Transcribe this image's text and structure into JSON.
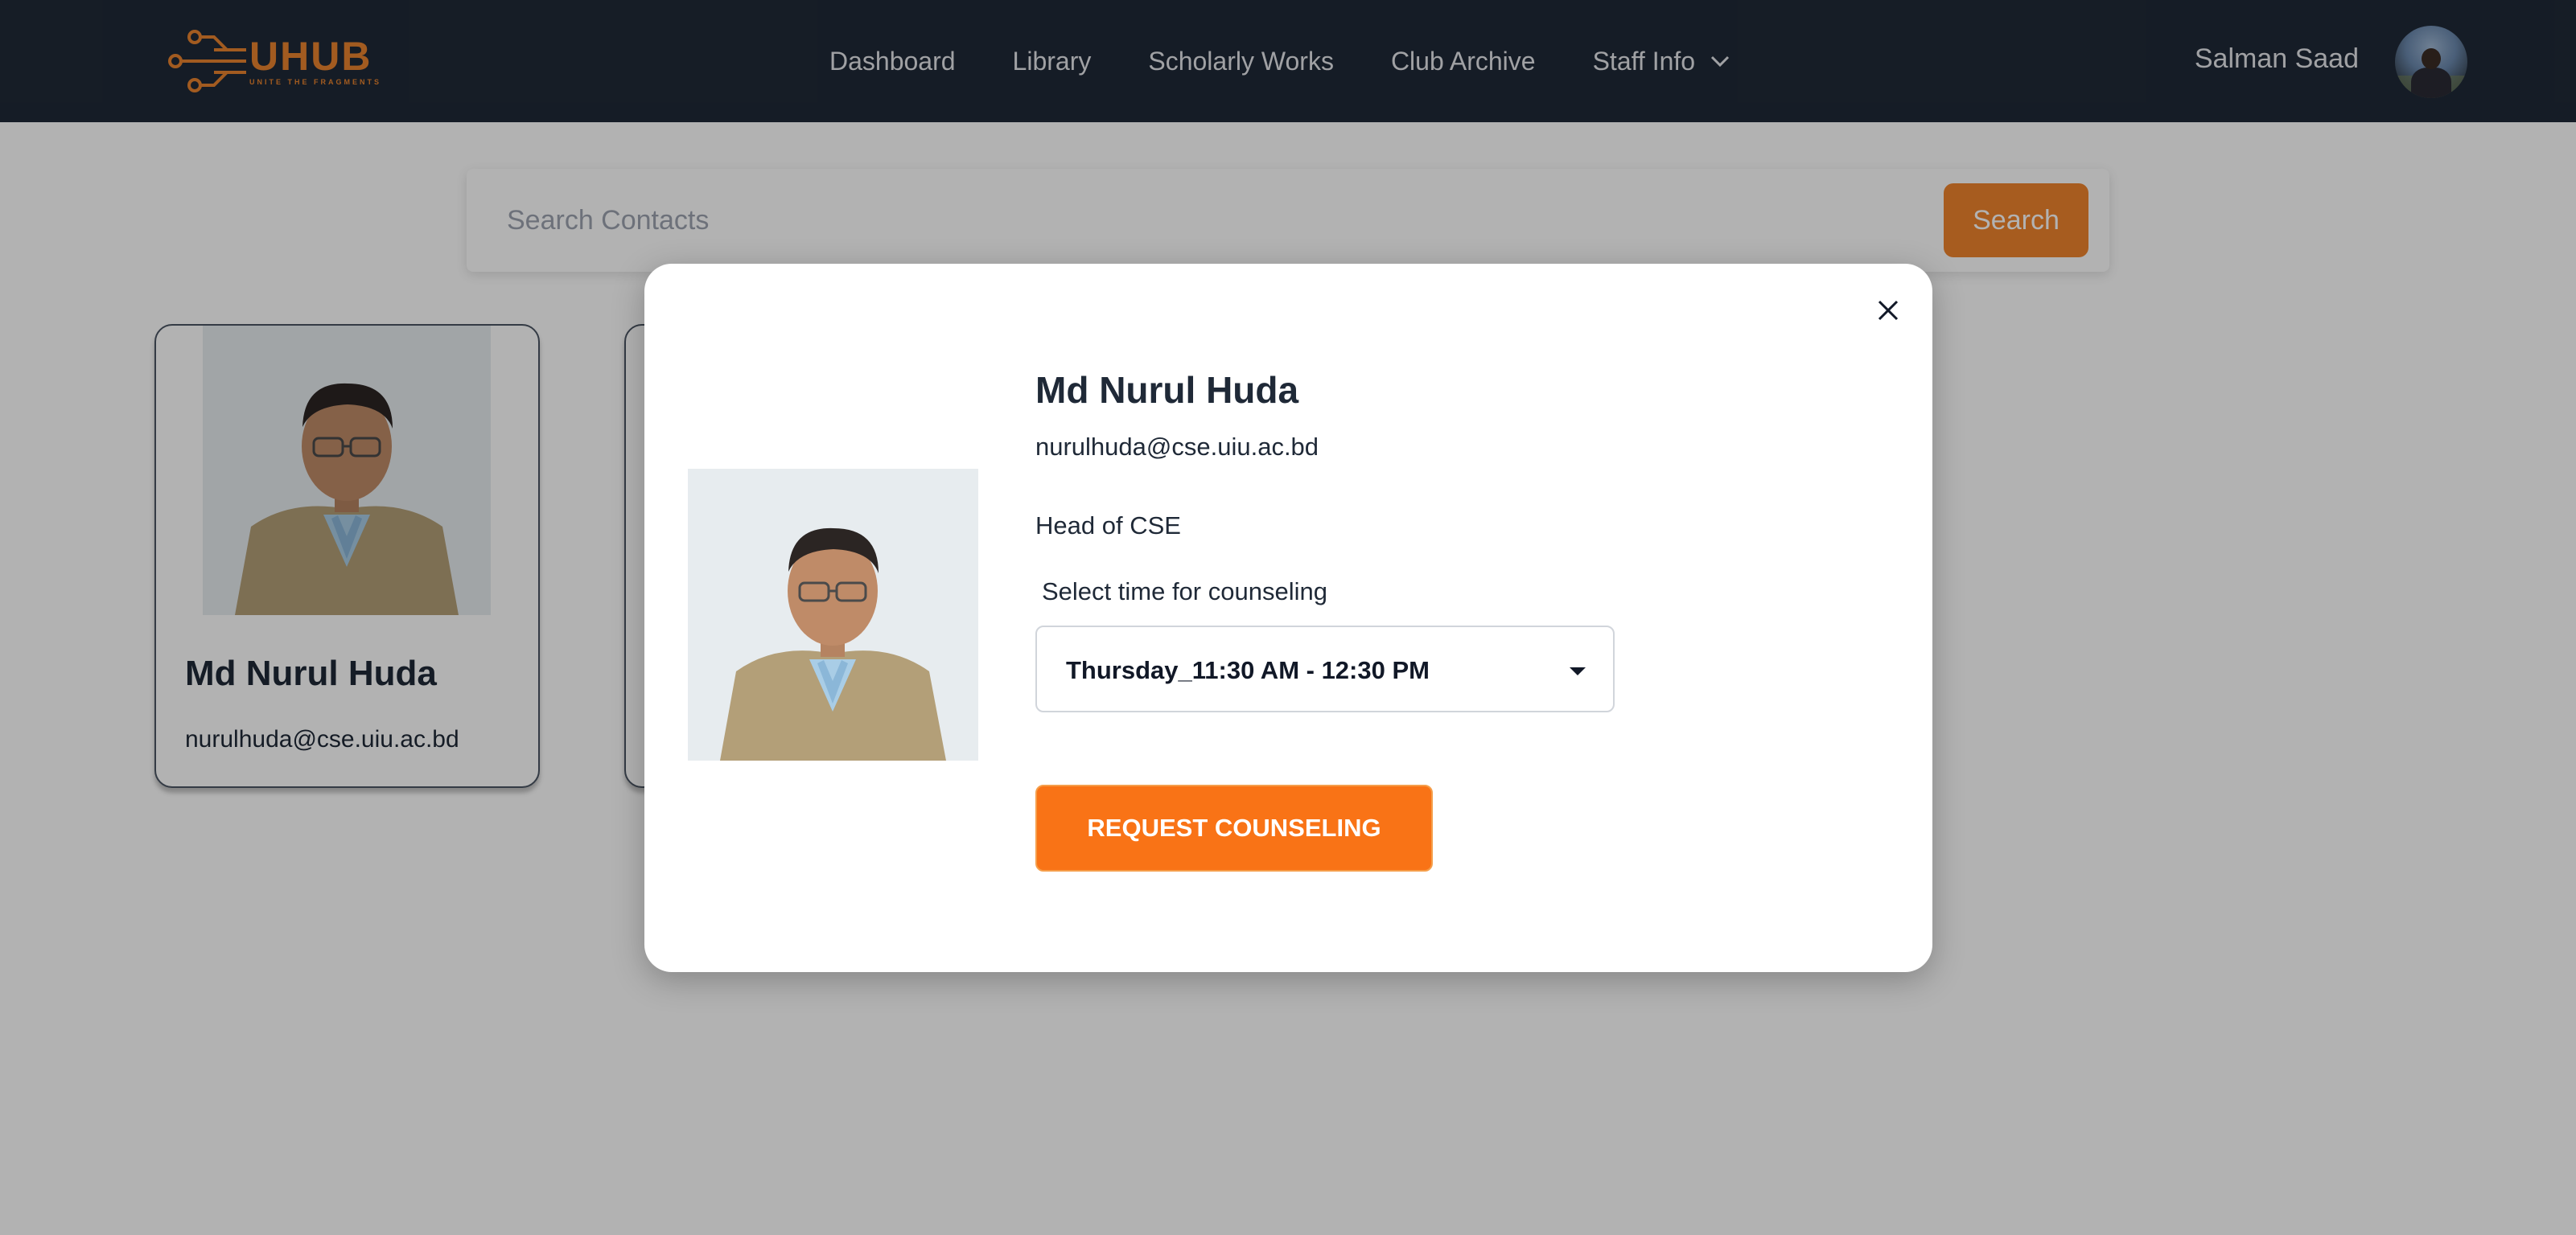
{
  "brand": {
    "logo_main": "UHUB",
    "logo_tagline": "UNITE THE FRAGMENTS",
    "accent_color": "#e8832e"
  },
  "nav": {
    "links": [
      "Dashboard",
      "Library",
      "Scholarly Works",
      "Club Archive"
    ],
    "dropdown_label": "Staff Info",
    "dropdown_icon": "chevron-down-icon"
  },
  "user": {
    "name": "Salman Saad",
    "avatar_icon": "user-avatar"
  },
  "search": {
    "placeholder": "Search Contacts",
    "value": "",
    "button_label": "Search"
  },
  "contacts": [
    {
      "name": "Md Nurul Huda",
      "email": "nurulhuda@cse.uiu.ac.bd"
    }
  ],
  "modal": {
    "name": "Md Nurul Huda",
    "email": "nurulhuda@cse.uiu.ac.bd",
    "role": "Head of CSE",
    "time_label": "Select time for counseling",
    "selected_time": "Thursday_11:30 AM - 12:30 PM",
    "request_button": "REQUEST COUNSELING",
    "close_icon": "close-icon"
  },
  "colors": {
    "navbar": "#1f2937",
    "primary_button": "#f97316",
    "overlay": "rgba(0,0,0,0.3)"
  }
}
